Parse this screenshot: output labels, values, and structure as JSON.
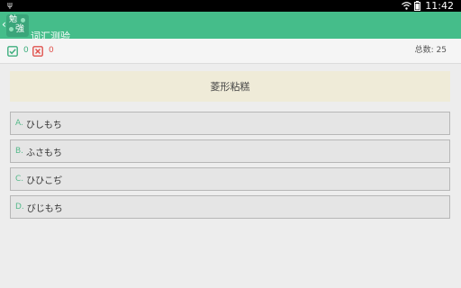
{
  "status_bar": {
    "time": "11:42",
    "icons": [
      "usb-icon",
      "wifi-icon",
      "battery-icon"
    ]
  },
  "app_bar": {
    "title": "词汇测验",
    "logo_text_top": "勉",
    "logo_text_bottom": "強",
    "back_glyph": "‹",
    "background_color": "#45bd8a"
  },
  "score": {
    "correct_count": "0",
    "wrong_count": "0",
    "total_label": "总数: 25",
    "correct_color": "#3fae7e",
    "wrong_color": "#e0524d"
  },
  "question": {
    "text": "菱形粘糕"
  },
  "options": [
    {
      "letter": "A.",
      "text": "ひしもち"
    },
    {
      "letter": "B.",
      "text": "ふさもち"
    },
    {
      "letter": "C.",
      "text": "ひひこぢ"
    },
    {
      "letter": "D.",
      "text": "びじもち"
    }
  ]
}
